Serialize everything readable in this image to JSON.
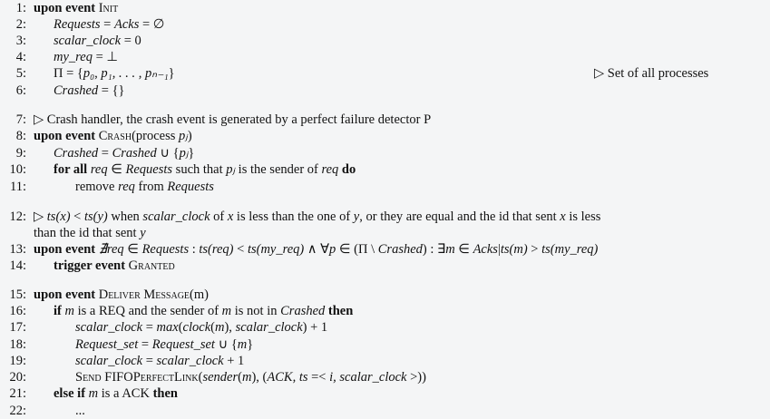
{
  "lines": [
    {
      "n": "1:",
      "indent": 0,
      "segs": [
        {
          "s": "b",
          "t": "upon event "
        },
        {
          "s": "sc",
          "t": "Init"
        }
      ]
    },
    {
      "n": "2:",
      "indent": 1,
      "segs": [
        {
          "s": "i",
          "t": "Requests"
        },
        {
          "s": "r",
          "t": " = "
        },
        {
          "s": "i",
          "t": "Acks"
        },
        {
          "s": "r",
          "t": " = ∅"
        }
      ]
    },
    {
      "n": "3:",
      "indent": 1,
      "segs": [
        {
          "s": "i",
          "t": "scalar_clock"
        },
        {
          "s": "r",
          "t": " = 0"
        }
      ]
    },
    {
      "n": "4:",
      "indent": 1,
      "segs": [
        {
          "s": "i",
          "t": "my_req"
        },
        {
          "s": "r",
          "t": " = ⊥"
        }
      ]
    },
    {
      "n": "5:",
      "indent": 1,
      "segs": [
        {
          "s": "r",
          "t": "Π = {"
        },
        {
          "s": "i",
          "t": "p₀, p₁, . . . , pₙ₋₁"
        },
        {
          "s": "r",
          "t": "}"
        }
      ],
      "comment": "▷ Set of all processes"
    },
    {
      "n": "6:",
      "indent": 1,
      "segs": [
        {
          "s": "i",
          "t": "Crashed"
        },
        {
          "s": "r",
          "t": " = {}"
        }
      ]
    },
    {
      "n": "7:",
      "indent": 0,
      "segs": [
        {
          "s": "r",
          "t": "▷ Crash handler, the crash event is generated by a perfect failure detector P"
        }
      ]
    },
    {
      "n": "8:",
      "indent": 0,
      "segs": [
        {
          "s": "b",
          "t": "upon event "
        },
        {
          "s": "sc",
          "t": "Crash"
        },
        {
          "s": "r",
          "t": "(process "
        },
        {
          "s": "i",
          "t": "pⱼ"
        },
        {
          "s": "r",
          "t": ")"
        }
      ]
    },
    {
      "n": "9:",
      "indent": 1,
      "segs": [
        {
          "s": "i",
          "t": "Crashed"
        },
        {
          "s": "r",
          "t": " = "
        },
        {
          "s": "i",
          "t": "Crashed"
        },
        {
          "s": "r",
          "t": " ∪ {"
        },
        {
          "s": "i",
          "t": "pⱼ"
        },
        {
          "s": "r",
          "t": "}"
        }
      ]
    },
    {
      "n": "10:",
      "indent": 1,
      "segs": [
        {
          "s": "b",
          "t": "for all "
        },
        {
          "s": "i",
          "t": "req"
        },
        {
          "s": "r",
          "t": " ∈ "
        },
        {
          "s": "i",
          "t": "Requests"
        },
        {
          "s": "r",
          "t": " such that "
        },
        {
          "s": "i",
          "t": "pⱼ"
        },
        {
          "s": "r",
          "t": " is the sender of "
        },
        {
          "s": "i",
          "t": "req"
        },
        {
          "s": "b",
          "t": " do"
        }
      ]
    },
    {
      "n": "11:",
      "indent": 2,
      "segs": [
        {
          "s": "r",
          "t": "remove "
        },
        {
          "s": "i",
          "t": "req"
        },
        {
          "s": "r",
          "t": " from "
        },
        {
          "s": "i",
          "t": "Requests"
        }
      ]
    },
    {
      "n": "12:",
      "indent": 0,
      "segs": [
        {
          "s": "r",
          "t": "▷ "
        },
        {
          "s": "i",
          "t": "ts(x)"
        },
        {
          "s": "r",
          "t": " < "
        },
        {
          "s": "i",
          "t": "ts(y)"
        },
        {
          "s": "r",
          "t": " when "
        },
        {
          "s": "i",
          "t": "scalar_clock"
        },
        {
          "s": "r",
          "t": " of "
        },
        {
          "s": "i",
          "t": "x"
        },
        {
          "s": "r",
          "t": " is less than the one of "
        },
        {
          "s": "i",
          "t": "y"
        },
        {
          "s": "r",
          "t": ", or they are equal and the id that sent "
        },
        {
          "s": "i",
          "t": "x"
        },
        {
          "s": "r",
          "t": " is less"
        }
      ]
    },
    {
      "n": "",
      "indent": 0.5,
      "segs": [
        {
          "s": "r",
          "t": "than the id that sent "
        },
        {
          "s": "i",
          "t": "y"
        }
      ]
    },
    {
      "n": "13:",
      "indent": 0,
      "segs": [
        {
          "s": "b",
          "t": "upon event "
        },
        {
          "s": "i",
          "t": "∄req"
        },
        {
          "s": "r",
          "t": " ∈ "
        },
        {
          "s": "i",
          "t": "Requests"
        },
        {
          "s": "r",
          "t": " : "
        },
        {
          "s": "i",
          "t": "ts(req)"
        },
        {
          "s": "r",
          "t": " < "
        },
        {
          "s": "i",
          "t": "ts(my_req)"
        },
        {
          "s": "r",
          "t": " ∧ ∀"
        },
        {
          "s": "i",
          "t": "p"
        },
        {
          "s": "r",
          "t": " ∈ (Π \\ "
        },
        {
          "s": "i",
          "t": "Crashed"
        },
        {
          "s": "r",
          "t": ") : ∃"
        },
        {
          "s": "i",
          "t": "m"
        },
        {
          "s": "r",
          "t": " ∈ "
        },
        {
          "s": "i",
          "t": "Acks"
        },
        {
          "s": "r",
          "t": "|"
        },
        {
          "s": "i",
          "t": "ts(m)"
        },
        {
          "s": "r",
          "t": " > "
        },
        {
          "s": "i",
          "t": "ts(my_req)"
        }
      ]
    },
    {
      "n": "14:",
      "indent": 1,
      "segs": [
        {
          "s": "b",
          "t": "trigger event "
        },
        {
          "s": "sc",
          "t": "Granted"
        }
      ]
    },
    {
      "n": "15:",
      "indent": 0,
      "segs": [
        {
          "s": "b",
          "t": "upon event "
        },
        {
          "s": "sc",
          "t": "Deliver Message"
        },
        {
          "s": "r",
          "t": "(m)"
        }
      ]
    },
    {
      "n": "16:",
      "indent": 1,
      "segs": [
        {
          "s": "b",
          "t": "if "
        },
        {
          "s": "i",
          "t": "m"
        },
        {
          "s": "r",
          "t": " is a REQ and the sender of "
        },
        {
          "s": "i",
          "t": "m"
        },
        {
          "s": "r",
          "t": " is not in "
        },
        {
          "s": "i",
          "t": "Crashed"
        },
        {
          "s": "b",
          "t": " then"
        }
      ]
    },
    {
      "n": "17:",
      "indent": 2,
      "segs": [
        {
          "s": "i",
          "t": "scalar_clock"
        },
        {
          "s": "r",
          "t": " = "
        },
        {
          "s": "i",
          "t": "max"
        },
        {
          "s": "r",
          "t": "("
        },
        {
          "s": "i",
          "t": "clock"
        },
        {
          "s": "r",
          "t": "("
        },
        {
          "s": "i",
          "t": "m"
        },
        {
          "s": "r",
          "t": "), "
        },
        {
          "s": "i",
          "t": "scalar_clock"
        },
        {
          "s": "r",
          "t": ") + 1"
        }
      ]
    },
    {
      "n": "18:",
      "indent": 2,
      "segs": [
        {
          "s": "i",
          "t": "Request_set"
        },
        {
          "s": "r",
          "t": " = "
        },
        {
          "s": "i",
          "t": "Request_set"
        },
        {
          "s": "r",
          "t": " ∪ {"
        },
        {
          "s": "i",
          "t": "m"
        },
        {
          "s": "r",
          "t": "}"
        }
      ]
    },
    {
      "n": "19:",
      "indent": 2,
      "segs": [
        {
          "s": "i",
          "t": "scalar_clock"
        },
        {
          "s": "r",
          "t": " = "
        },
        {
          "s": "i",
          "t": "scalar_clock"
        },
        {
          "s": "r",
          "t": " + 1"
        }
      ]
    },
    {
      "n": "20:",
      "indent": 2,
      "segs": [
        {
          "s": "sc",
          "t": "Send"
        },
        {
          "s": "r",
          "t": " FIFO"
        },
        {
          "s": "sc",
          "t": "PerfectLink"
        },
        {
          "s": "r",
          "t": "("
        },
        {
          "s": "i",
          "t": "sender"
        },
        {
          "s": "r",
          "t": "("
        },
        {
          "s": "i",
          "t": "m"
        },
        {
          "s": "r",
          "t": "), ("
        },
        {
          "s": "i",
          "t": "ACK, ts"
        },
        {
          "s": "r",
          "t": " =< "
        },
        {
          "s": "i",
          "t": "i, scalar_clock"
        },
        {
          "s": "r",
          "t": " >))"
        }
      ]
    },
    {
      "n": "21:",
      "indent": 1,
      "segs": [
        {
          "s": "b",
          "t": "else if "
        },
        {
          "s": "i",
          "t": "m"
        },
        {
          "s": "r",
          "t": " is a ACK "
        },
        {
          "s": "b",
          "t": "then"
        }
      ]
    },
    {
      "n": "22:",
      "indent": 2,
      "segs": [
        {
          "s": "r",
          "t": "..."
        }
      ]
    }
  ]
}
